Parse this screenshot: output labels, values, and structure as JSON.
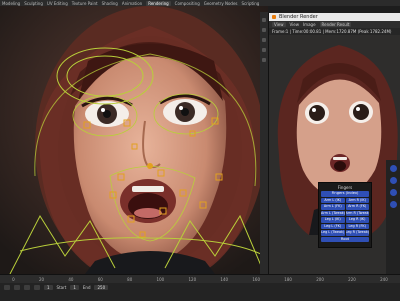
{
  "topbar": {
    "tabs": [
      "Modeling",
      "Sculpting",
      "UV Editing",
      "Texture Paint",
      "Shading",
      "Animation",
      "Rendering",
      "Compositing",
      "Geometry Nodes",
      "Scripting"
    ],
    "active_index": 6
  },
  "render_window": {
    "title": "Blender Render",
    "menu": [
      "View",
      "View",
      "Image",
      "Render Result"
    ],
    "info": "Frame:1 | Time:00:00.81 | Mem:1720.87M (Peak 1782.24M)"
  },
  "rig_panel": {
    "title": "Fingers",
    "top_button": "Fingers (Index)",
    "pairs": [
      [
        "Arm L (IK)",
        "Arm R (IK)"
      ],
      [
        "Arm L (FK)",
        "Arm R (FK)"
      ],
      [
        "Arm L (Tweak)",
        "Arm R (Tweak)"
      ],
      [
        "Leg L (IK)",
        "Leg R (IK)"
      ],
      [
        "Leg L (FK)",
        "Leg R (FK)"
      ],
      [
        "Leg L (Tweak)",
        "Leg R (Tweak)"
      ]
    ],
    "bottom_button": "Root"
  },
  "timeline": {
    "ruler": [
      "0",
      "20",
      "40",
      "60",
      "80",
      "100",
      "120",
      "140",
      "160",
      "180",
      "200",
      "220",
      "240"
    ],
    "start_label": "Start",
    "start": "1",
    "end_label": "End",
    "end": "250",
    "current_frame": "1"
  },
  "colors": {
    "accent": "#2f4fb5",
    "rig_lines": "#b9cf3a",
    "rig_bones": "#e2a020"
  }
}
